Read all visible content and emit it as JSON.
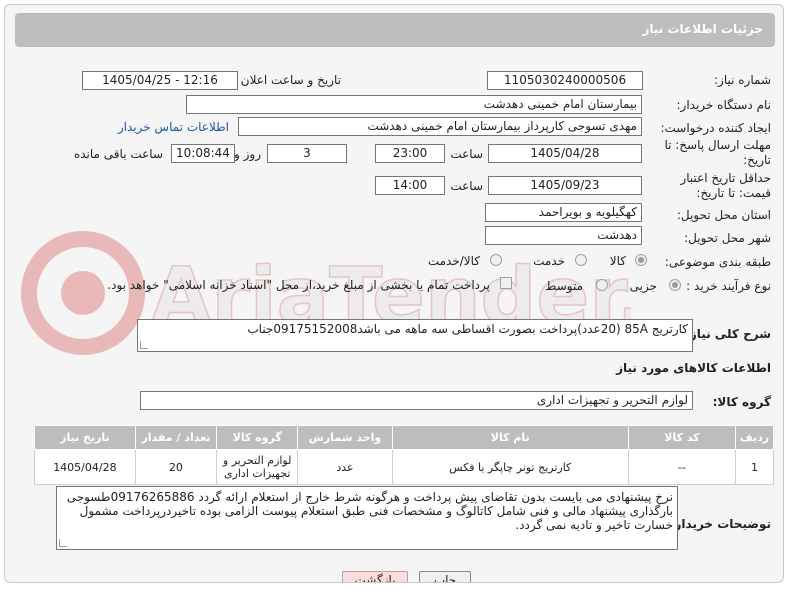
{
  "header_title": "جزئیات اطلاعات نیاز",
  "watermark_text": "AriaTender.net",
  "need_number": {
    "label": "شماره نیاز:",
    "value": "1105030240000506"
  },
  "announce": {
    "label": "تاریخ و ساعت اعلان عمومی:",
    "value": "1405/04/25 - 12:16"
  },
  "buyer_org": {
    "label": "نام دستگاه خریدار:",
    "value": "بیمارستان امام خمینی دهدشت"
  },
  "requester": {
    "label": "ایجاد کننده درخواست:",
    "value": "مهدی تسوجی کارپرداز بیمارستان امام خمینی دهدشت",
    "link": "اطلاعات تماس خریدار"
  },
  "deadline": {
    "label": "مهلت ارسال پاسخ: تا تاریخ:",
    "date": "1405/04/28",
    "time_label": "ساعت",
    "time": "23:00",
    "days": "3",
    "days_label": "روز و",
    "remaining": "10:08:44",
    "remaining_label": "ساعت باقی مانده"
  },
  "validity": {
    "label": "حداقل تاریخ اعتبار قیمت: تا تاریخ:",
    "date": "1405/09/23",
    "time_label": "ساعت",
    "time": "14:00"
  },
  "province": {
    "label": "استان محل تحویل:",
    "value": "کهگیلویه و بویراحمد"
  },
  "city": {
    "label": "شهر محل تحویل:",
    "value": "دهدشت"
  },
  "category": {
    "label": "طبقه بندی موضوعی:",
    "options": [
      "کالا",
      "خدمت",
      "کالا/خدمت"
    ]
  },
  "process": {
    "label": "نوع فرآیند خرید :",
    "options": [
      "جزیی",
      "متوسط"
    ],
    "payment_note": "پرداخت تمام یا بخشی از مبلغ خرید،از محل \"اسناد خزانه اسلامی\" خواهد بود."
  },
  "summary": {
    "label": "شرح کلی نیاز:",
    "value": "کارتریج 85A (20عدد)پرداخت بصورت اقساطی سه ماهه می باشد09175152008جناب"
  },
  "goods_info_title": "اطلاعات کالاهای مورد نیاز",
  "goods_group": {
    "label": "گروه کالا:",
    "value": "لوازم التحریر و تجهیزات اداری"
  },
  "table": {
    "headers": [
      "ردیف",
      "کد کالا",
      "نام کالا",
      "واحد شمارش",
      "گروه کالا",
      "تعداد / مقدار",
      "تاریخ نیاز"
    ],
    "rows": [
      [
        "1",
        "--",
        "کارتریج تونر چاپگر یا فکس",
        "عدد",
        "لوازم التحریر و تجهیزات اداری",
        "20",
        "1405/04/28"
      ]
    ]
  },
  "buyer_notes": {
    "label": "توضیحات خریدار:",
    "value": "نرخ پیشنهادی می بایست بدون تقاضای پیش پرداخت و هرگونه شرط خارج از استعلام ارائه گردد 09176265886طسوجی بارگذاری پیشنهاد مالی و فنی شامل کاتالوگ و مشخصات فنی طبق استعلام پیوست الزامی بوده تاخیردرپرداخت مشمول خسارت تاخیر و تادیه نمی گردد."
  },
  "buttons": {
    "print": "چاپ",
    "back": "بازگشت"
  },
  "colors": {
    "header": "#bdbdbd",
    "link": "#1a5aa8",
    "back_button": "#f9dede",
    "watermark": "#e9b8b8"
  }
}
